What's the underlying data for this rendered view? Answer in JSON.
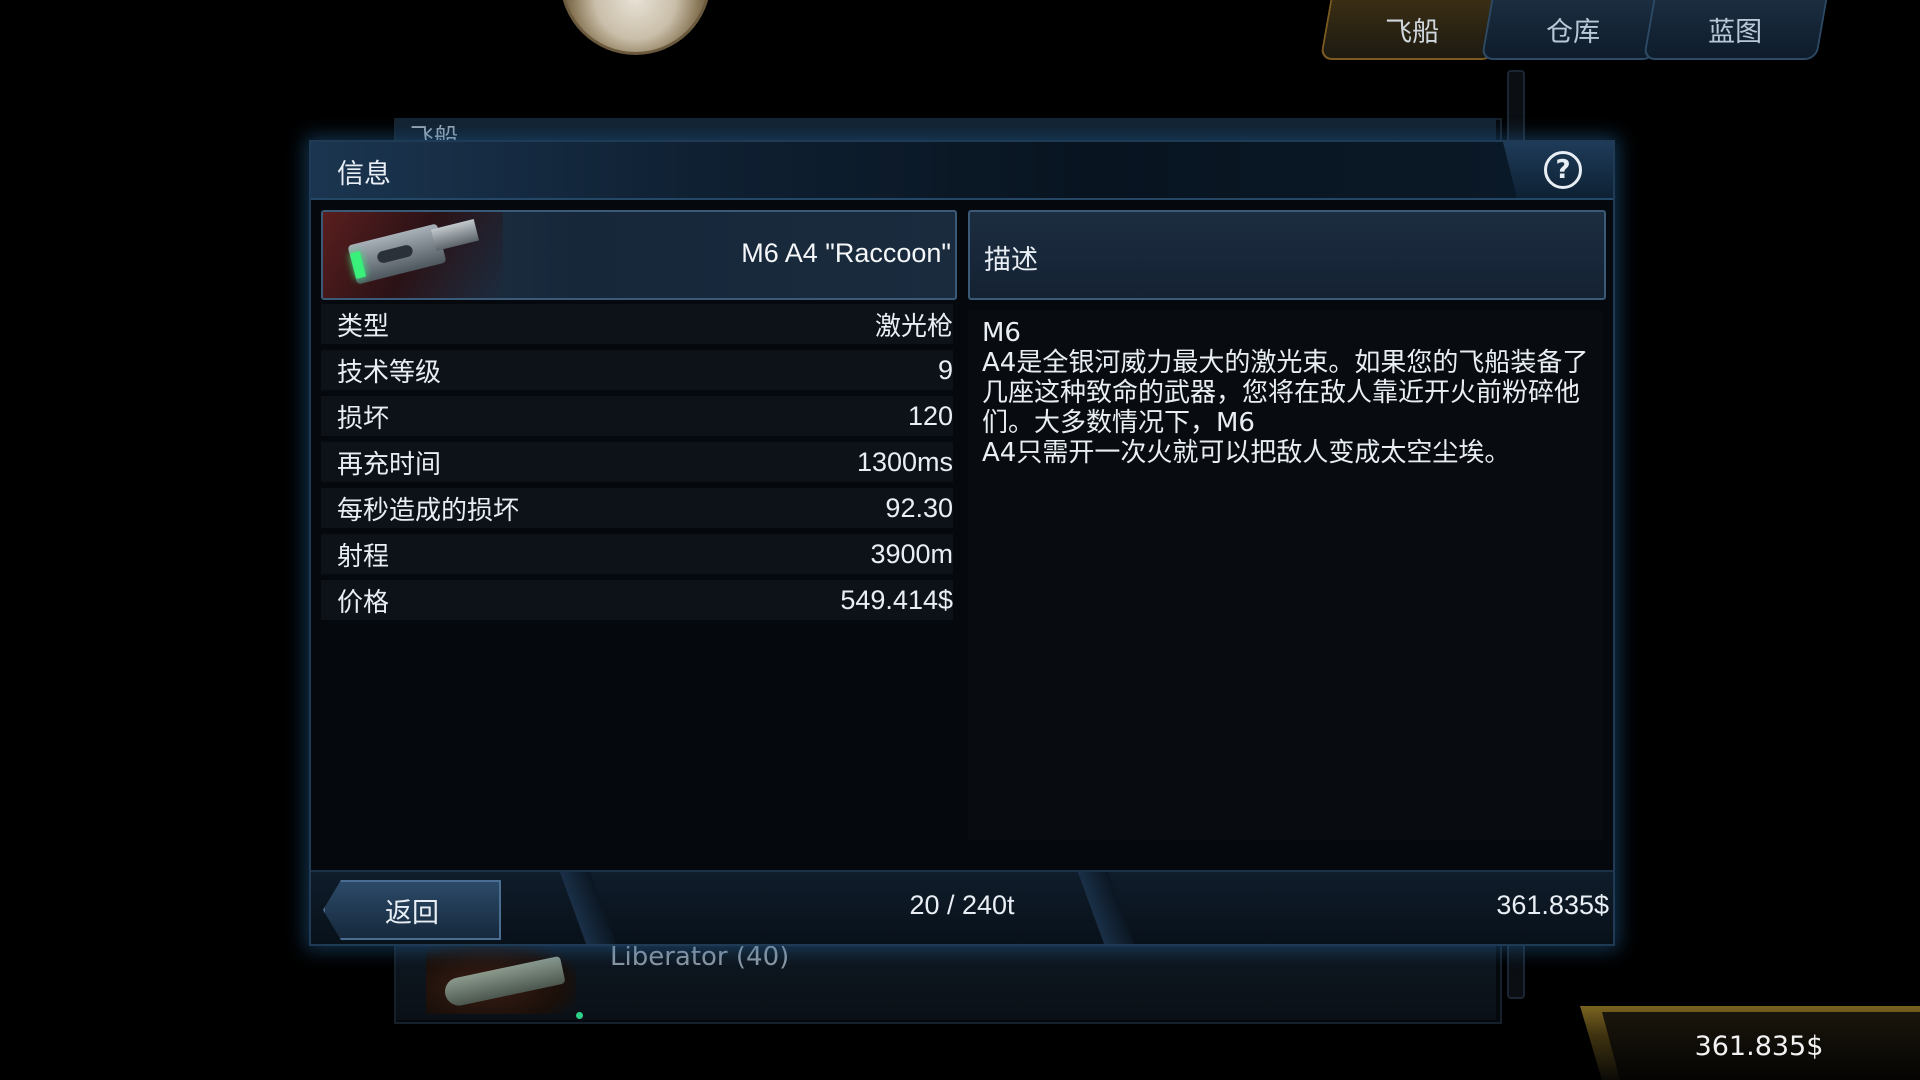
{
  "top_tabs": [
    {
      "label": "飞船",
      "active": true
    },
    {
      "label": "仓库",
      "active": false
    },
    {
      "label": "蓝图",
      "active": false
    }
  ],
  "background": {
    "list_header": "飞船",
    "ship_name": "Liberator (40)",
    "money": "361.835$"
  },
  "modal": {
    "title": "信息",
    "help_icon": "question-mark-icon",
    "item": {
      "name": "M6 A4 \"Raccoon\"",
      "icon": "laser-gun-icon"
    },
    "stats": [
      {
        "label": "类型",
        "value": "激光枪"
      },
      {
        "label": "技术等级",
        "value": "9"
      },
      {
        "label": "损坏",
        "value": "120"
      },
      {
        "label": "再充时间",
        "value": "1300ms"
      },
      {
        "label": "每秒造成的损坏",
        "value": "92.30"
      },
      {
        "label": "射程",
        "value": "3900m"
      },
      {
        "label": "价格",
        "value": "549.414$"
      }
    ],
    "description_header": "描述",
    "description": "M6\nA4是全银河威力最大的激光束。如果您的飞船装备了几座这种致命的武器，您将在敌人靠近开火前粉碎他们。大多数情况下，M6\nA4只需开一次火就可以把敌人变成太空尘埃。",
    "footer": {
      "back_label": "返回",
      "cargo": "20 / 240t",
      "money": "361.835$"
    }
  },
  "colors": {
    "accent_blue": "#1e3a55",
    "active_tab_gold": "#7a5a20",
    "laser_glow_green": "#38f07a"
  }
}
